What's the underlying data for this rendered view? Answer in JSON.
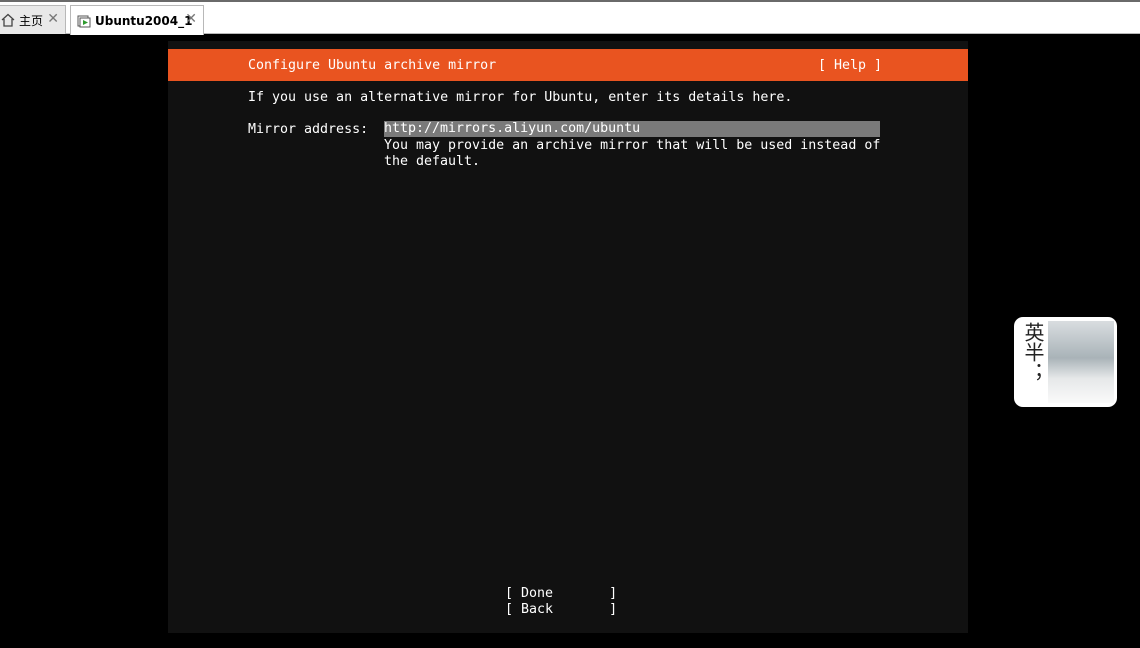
{
  "tabs": [
    {
      "label": "主页",
      "icon": "home-icon",
      "active": false
    },
    {
      "label": "Ubuntu2004_1",
      "icon": "vm-icon",
      "active": true
    }
  ],
  "close_glyph": "✕",
  "installer": {
    "title": "Configure Ubuntu archive mirror",
    "help_label": "[ Help ]",
    "intro": "If you use an alternative mirror for Ubuntu, enter its details here.",
    "mirror_label": "Mirror address:",
    "mirror_value": "http://mirrors.aliyun.com/ubuntu",
    "mirror_help": "You may provide an archive mirror that will be used instead of\nthe default.",
    "buttons": {
      "done": "[ Done       ]",
      "back": "[ Back       ]"
    }
  },
  "widget": {
    "text": "英半；"
  },
  "colors": {
    "accent": "#e95420",
    "panel_bg": "#111111",
    "input_bg": "#7a7a7a"
  }
}
